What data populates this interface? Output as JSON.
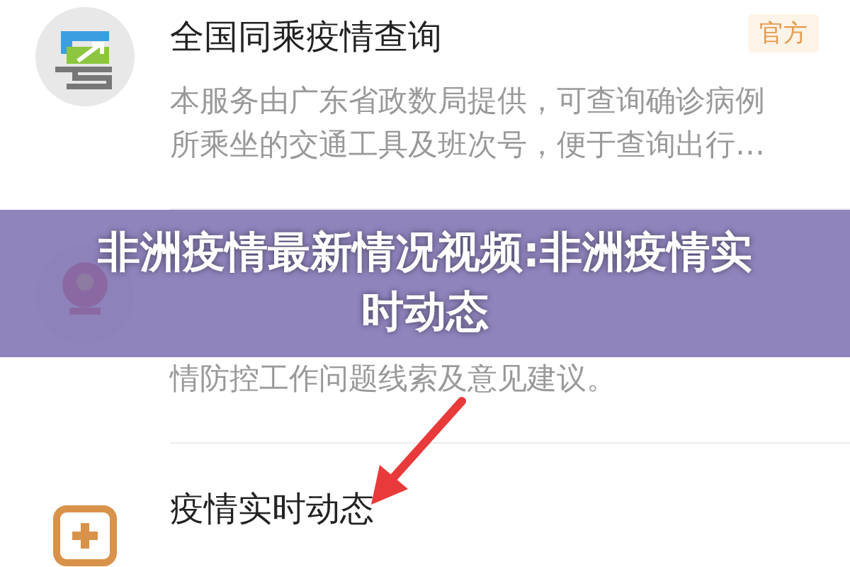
{
  "items": [
    {
      "title": "全国同乘疫情查询",
      "badge": "官方",
      "description": "本服务由广东省政数局提供，可查询确诊病例所乘坐的交通工具及班次号，便于查询出行…"
    },
    {
      "description": "情防控工作问题线索及意见建议。"
    },
    {
      "title": "疫情实时动态"
    }
  ],
  "banner": {
    "title": "非洲疫情最新情况视频:非洲疫情实时动态"
  }
}
